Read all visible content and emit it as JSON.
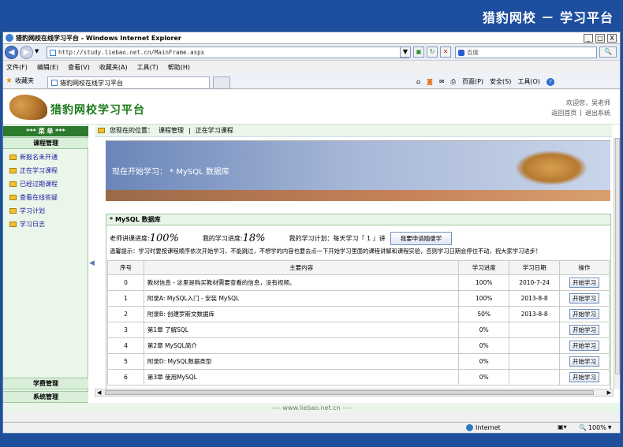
{
  "banner": {
    "title": "猎豹网校 － 学习平台"
  },
  "window": {
    "title": "猎豹网校在线学习平台 - Windows Internet Explorer",
    "min": "_",
    "max": "□",
    "close": "X"
  },
  "address": {
    "url": "http://study.liebao.net.cn/MainFrame.aspx",
    "search_placeholder": "百度"
  },
  "menu": [
    "文件(F)",
    "编辑(E)",
    "查看(V)",
    "收藏夹(A)",
    "工具(T)",
    "帮助(H)"
  ],
  "favbar": {
    "favorites": "收藏夹",
    "tab_title": "猎豹网校在线学习平台",
    "page": "页面(P)",
    "safety": "安全(S)",
    "tools": "工具(O)",
    "help": "?"
  },
  "site": {
    "logo": "猎豹网校学习平台",
    "welcome": "欢迎您，吴老师",
    "home": "返回首页",
    "sep": "|",
    "logout": "退出系统"
  },
  "sidebar": {
    "menu_title": "*** 菜 单 ***",
    "section1": "课程管理",
    "items": [
      "新报名未开通",
      "正在学习课程",
      "已经过期课程",
      "查看在线答疑",
      "学习计划",
      "学习日志"
    ],
    "section2": "学费管理",
    "section3": "系统管理"
  },
  "breadcrumb": {
    "prefix": "您现在的位置：",
    "level1": "课程管理",
    "sep": "|",
    "level2": "正在学习课程"
  },
  "hero": {
    "text": "现在开始学习：  * MySQL 数据库"
  },
  "course": {
    "title": "* MySQL 数据库",
    "teacher_label": "老师讲课进度:",
    "teacher_progress": "100%",
    "my_label": "我的学习进度:",
    "my_progress": "18%",
    "plan": "我的学习计划：每天学习『 1 』讲",
    "plan_button": "我要申请随便学",
    "tip": "温馨提示：学习时要按课程顺序依次开始学习，不能跳过，不想学的内容也要去点一下开始学习里面的课程讲解和课程实验，否则学习日期会停住不动，祝大家学习进步！",
    "headers": [
      "序号",
      "主要内容",
      "学习进度",
      "学习日期",
      "操作"
    ],
    "rows": [
      {
        "no": "0",
        "content": "教材信息 - 这里是购买教材需要查看的信息，没有视频。",
        "progress": "100%",
        "date": "2010-7-24",
        "action": "开始学习"
      },
      {
        "no": "1",
        "content": "附录A: MySQL入门 - 安装 MySQL",
        "progress": "100%",
        "date": "2013-8-8",
        "action": "开始学习"
      },
      {
        "no": "2",
        "content": "附录B: 创建罗斯文数据库",
        "progress": "50%",
        "date": "2013-8-8",
        "action": "开始学习"
      },
      {
        "no": "3",
        "content": "第1章 了解SQL",
        "progress": "0%",
        "date": "",
        "action": "开始学习"
      },
      {
        "no": "4",
        "content": "第2章 MySQL简介",
        "progress": "0%",
        "date": "",
        "action": "开始学习"
      },
      {
        "no": "5",
        "content": "附录D: MySQL数据类型",
        "progress": "0%",
        "date": "",
        "action": "开始学习"
      },
      {
        "no": "6",
        "content": "第3章 使用MySQL",
        "progress": "0%",
        "date": "",
        "action": "开始学习"
      }
    ]
  },
  "footer": {
    "text": "---- www.liebao.net.cn ----"
  },
  "status": {
    "zone": "Internet",
    "zoom": "100%"
  }
}
